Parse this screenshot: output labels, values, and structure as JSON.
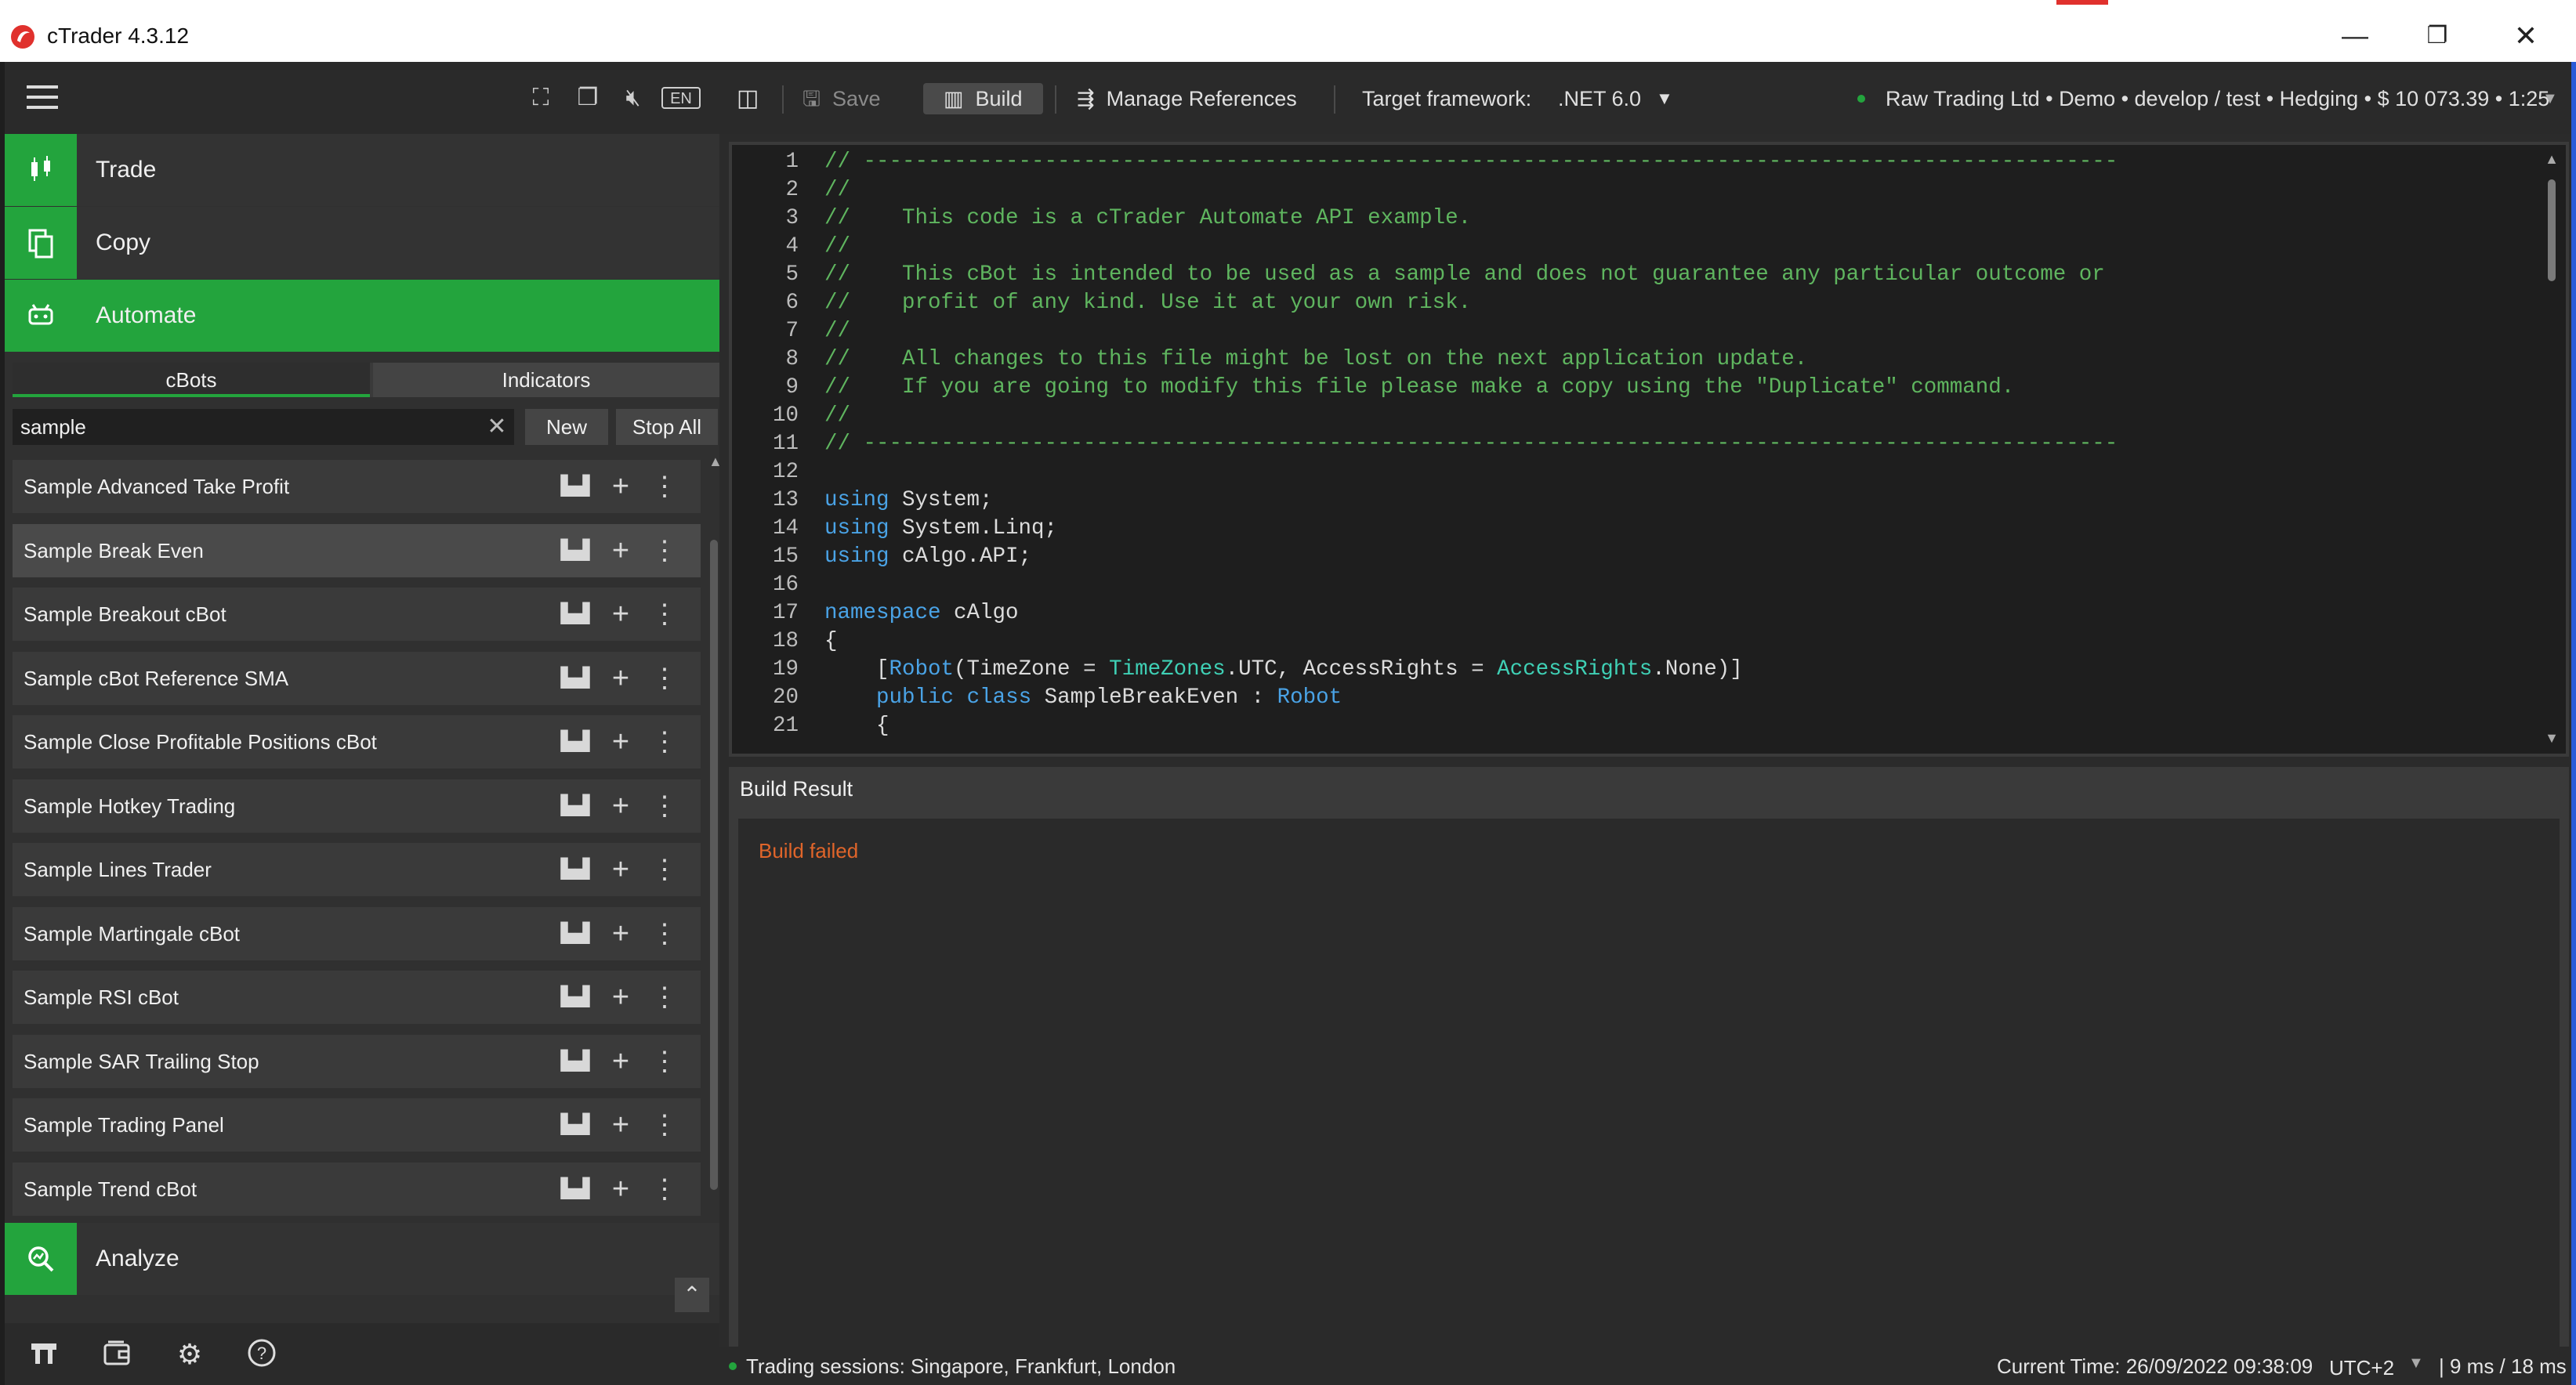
{
  "window": {
    "title": "cTrader 4.3.12",
    "min_glyph": "—",
    "max_glyph": "❐",
    "close_glyph": "✕"
  },
  "leftpanel": {
    "lang_badge": "EN",
    "nav": [
      {
        "label": "Trade",
        "icon": "trade-icon"
      },
      {
        "label": "Copy",
        "icon": "copy-icon"
      },
      {
        "label": "Automate",
        "icon": "automate-icon"
      },
      {
        "label": "Analyze",
        "icon": "analyze-icon"
      }
    ],
    "tabs": {
      "cbots": "cBots",
      "indicators": "Indicators"
    },
    "search": {
      "value": "sample"
    },
    "buttons": {
      "new": "New",
      "stop_all": "Stop All"
    },
    "bots": [
      "Sample Advanced Take Profit",
      "Sample Break Even",
      "Sample Breakout cBot",
      "Sample cBot Reference SMA",
      "Sample Close Profitable Positions cBot",
      "Sample Hotkey Trading",
      "Sample Lines Trader",
      "Sample Martingale cBot",
      "Sample RSI cBot",
      "Sample SAR Trailing Stop",
      "Sample Trading Panel",
      "Sample Trend cBot"
    ],
    "selected_bot": "Sample Break Even"
  },
  "toolbar": {
    "save": "Save",
    "build": "Build",
    "manage_references": "Manage References",
    "target_framework_label": "Target framework:",
    "target_framework_value": ".NET 6.0",
    "account": "Raw Trading Ltd • Demo • develop / test • Hedging • $ 10 073.39 • 1:25"
  },
  "editor": {
    "line_numbers": "1\n2\n3\n4\n5\n6\n7\n8\n9\n10\n11\n12\n13\n14\n15\n16\n17\n18\n19\n20\n21",
    "lines": [
      "// -------------------------------------------------------------------------------------------------",
      "//",
      "//    This code is a cTrader Automate API example.",
      "//",
      "//    This cBot is intended to be used as a sample and does not guarantee any particular outcome or",
      "//    profit of any kind. Use it at your own risk.",
      "//",
      "//    All changes to this file might be lost on the next application update.",
      "//    If you are going to modify this file please make a copy using the \"Duplicate\" command.",
      "//",
      "// -------------------------------------------------------------------------------------------------",
      "",
      "using System;",
      "using System.Linq;",
      "using cAlgo.API;",
      "",
      "namespace cAlgo",
      "{",
      "    [Robot(TimeZone = TimeZones.UTC, AccessRights = AccessRights.None)]",
      "    public class SampleBreakEven : Robot",
      "    {"
    ]
  },
  "build_result": {
    "tab": "Build Result",
    "message": "Build failed"
  },
  "status": {
    "sessions": "Trading sessions: Singapore, Frankfurt, London",
    "current_time": "Current Time:  26/09/2022 09:38:09",
    "timezone": "UTC+2",
    "ping": "| 9 ms / 18 ms"
  },
  "colors": {
    "accent_green": "#23a43d",
    "error_orange": "#e0652a",
    "comment_green": "#5fb55f",
    "keyword_blue": "#4aa3e6",
    "type_teal": "#3fd0b5"
  }
}
